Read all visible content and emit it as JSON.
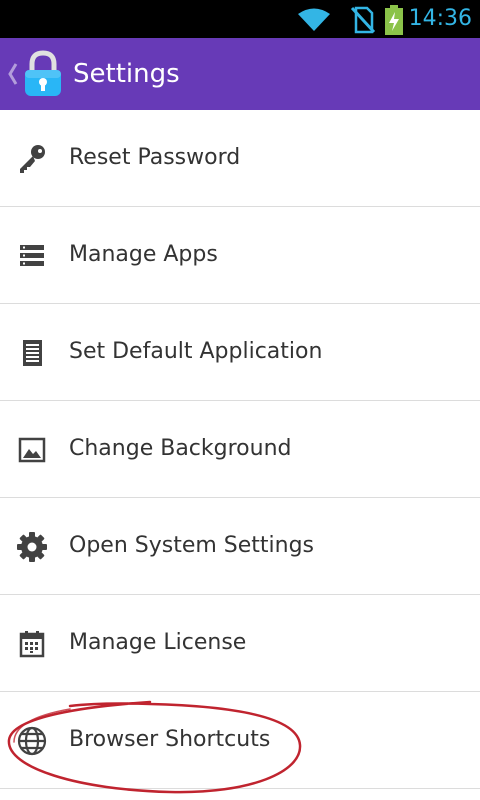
{
  "status_bar": {
    "time": "14:36",
    "icons": [
      "wifi-icon",
      "no-sim-icon",
      "battery-charging-icon"
    ]
  },
  "app_bar": {
    "title": "Settings",
    "back_icon": "chevron-left-icon",
    "logo_icon": "lock-icon"
  },
  "settings": {
    "items": [
      {
        "label": "Reset Password",
        "icon": "key-icon"
      },
      {
        "label": "Manage Apps",
        "icon": "list-icon"
      },
      {
        "label": "Set Default Application",
        "icon": "document-icon"
      },
      {
        "label": "Change Background",
        "icon": "image-icon"
      },
      {
        "label": "Open System Settings",
        "icon": "gear-icon"
      },
      {
        "label": "Manage License",
        "icon": "calendar-icon"
      },
      {
        "label": "Browser Shortcuts",
        "icon": "globe-icon"
      }
    ]
  },
  "colors": {
    "app_bar": "#673ab7",
    "status_accent": "#33b5e5",
    "annotation": "#c0242f"
  }
}
